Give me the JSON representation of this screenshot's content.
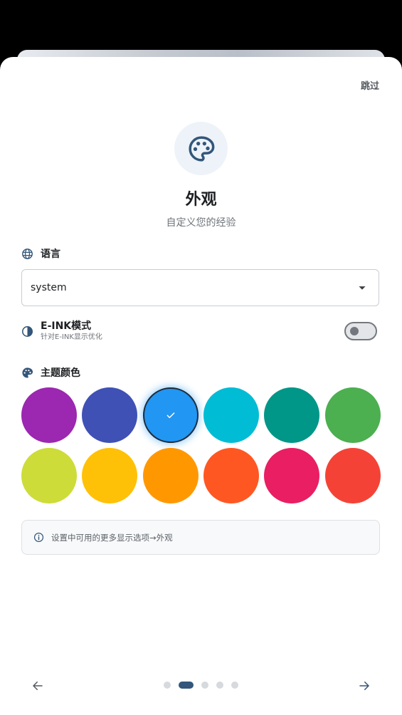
{
  "header": {
    "skip_label": "跳过"
  },
  "hero": {
    "icon": "palette-icon",
    "title": "外观",
    "subtitle": "自定义您的经验"
  },
  "language": {
    "label": "语言",
    "icon": "globe-icon",
    "selected": "system"
  },
  "eink": {
    "title": "E-INK模式",
    "subtitle": "针对E-INK显示优化",
    "icon": "contrast-icon",
    "enabled": false
  },
  "theme": {
    "label": "主题颜色",
    "icon": "palette-icon",
    "selected_index": 2,
    "colors": [
      "#9C27B0",
      "#3F51B5",
      "#2196F3",
      "#00BCD4",
      "#009688",
      "#4CAF50",
      "#CDDC39",
      "#FFC107",
      "#FF9800",
      "#FF5722",
      "#E91E63",
      "#F44336"
    ]
  },
  "info": {
    "text": "设置中可用的更多显示选项→外观",
    "icon": "info-icon"
  },
  "pager": {
    "count": 5,
    "active_index": 1
  },
  "colors": {
    "accent": "#33567a",
    "selected_theme": "#2196F3"
  }
}
